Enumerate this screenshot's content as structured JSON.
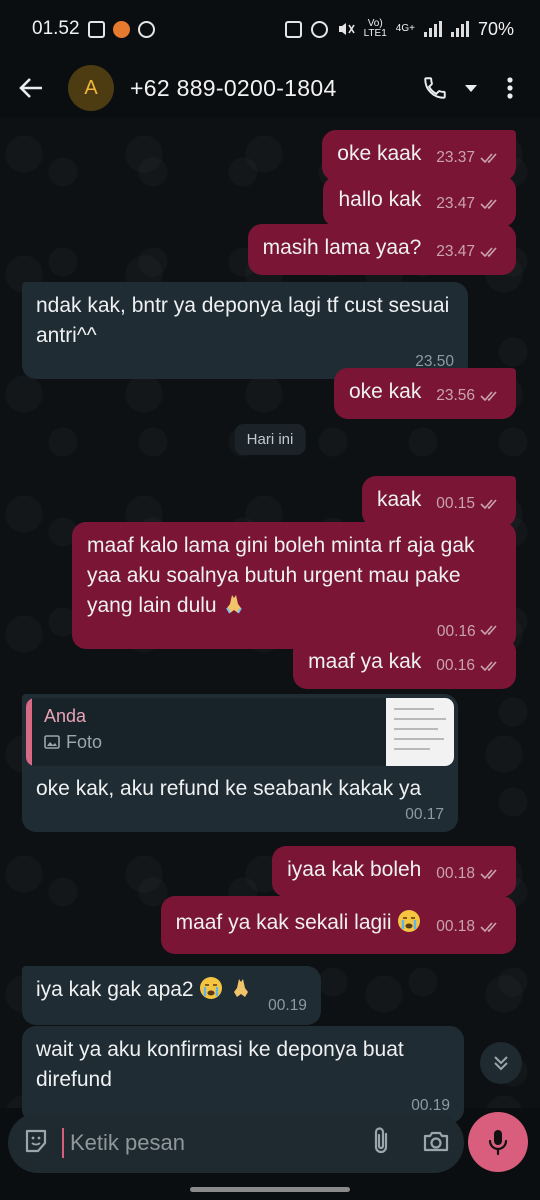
{
  "status_bar": {
    "time": "01.52",
    "network": "4G+",
    "lte": "LTE1",
    "volte": "Vo)",
    "battery": "70%"
  },
  "header": {
    "avatar_letter": "A",
    "contact": "+62 889-0200-1804"
  },
  "date_divider": "Hari ini",
  "messages": [
    {
      "text": "oke kaak",
      "time": "23.37"
    },
    {
      "text": "hallo kak",
      "time": "23.47"
    },
    {
      "text": "masih lama yaa?",
      "time": "23.47"
    },
    {
      "text": "ndak kak, bntr ya deponya lagi tf cust sesuai antri^^",
      "time": "23.50"
    },
    {
      "text": "oke kak",
      "time": "23.56"
    },
    {
      "text": "kaak",
      "time": "00.15"
    },
    {
      "text": "maaf kalo lama gini boleh minta rf aja gak yaa aku soalnya butuh urgent mau pake yang lain dulu",
      "time": "00.16"
    },
    {
      "text": "maaf ya kak",
      "time": "00.16"
    },
    {
      "quote_author": "Anda",
      "quote_type": "Foto",
      "text": "oke kak, aku refund ke seabank kakak ya",
      "time": "00.17"
    },
    {
      "text": "iyaa kak boleh",
      "time": "00.18"
    },
    {
      "text": "maaf ya kak sekali lagii",
      "time": "00.18"
    },
    {
      "text": "iya kak gak apa2",
      "time": "00.19"
    },
    {
      "text": "wait ya aku konfirmasi ke deponya buat direfund",
      "time": "00.19"
    }
  ],
  "composer": {
    "placeholder": "Ketik pesan"
  },
  "colors": {
    "outgoing": "#7a1535",
    "incoming": "#1f2c34",
    "accent": "#d95d7d"
  }
}
